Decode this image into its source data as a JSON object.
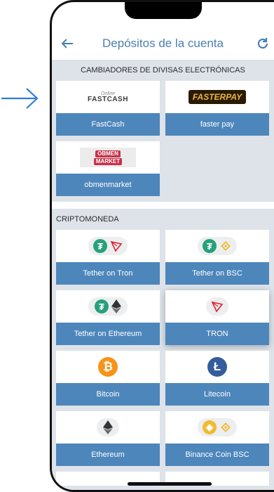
{
  "header": {
    "title": "Depósitos de la cuenta",
    "back_icon": "arrow-left-icon",
    "refresh_icon": "refresh-icon"
  },
  "sections": [
    {
      "heading": "CAMBIADORES DE DIVISAS ELECTRÓNICAS",
      "items": [
        {
          "label": "FastCash",
          "logo_text": "FASTCASH",
          "logo_sub": "Online"
        },
        {
          "label": "faster pay",
          "logo_text": "FASTERPAY"
        },
        {
          "label": "obmenmarket",
          "logo_text": "OBMEN",
          "logo_sub2": "MARKET"
        }
      ]
    },
    {
      "heading": "CRIPTOMONEDA",
      "items": [
        {
          "label": "Tether on Tron",
          "icons": [
            "tether-icon",
            "tron-icon"
          ]
        },
        {
          "label": "Tether on BSC",
          "icons": [
            "tether-icon",
            "bnb-icon"
          ]
        },
        {
          "label": "Tether on Ethereum",
          "icons": [
            "tether-icon",
            "ethereum-icon"
          ]
        },
        {
          "label": "TRON",
          "icons": [
            "tron-icon"
          ],
          "highlighted": true
        },
        {
          "label": "Bitcoin",
          "icons": [
            "bitcoin-icon"
          ]
        },
        {
          "label": "Litecoin",
          "icons": [
            "litecoin-icon"
          ]
        },
        {
          "label": "Ethereum",
          "icons": [
            "ethereum-icon"
          ]
        },
        {
          "label": "Binance Coin BSC",
          "icons": [
            "binance-coin-icon",
            "bnb-icon"
          ]
        }
      ]
    }
  ],
  "colors": {
    "accent": "#4a7fb1",
    "card_label_bg": "#4d86bb",
    "content_bg": "#dde3e9",
    "pointer_arrow": "#2f7fd3"
  }
}
